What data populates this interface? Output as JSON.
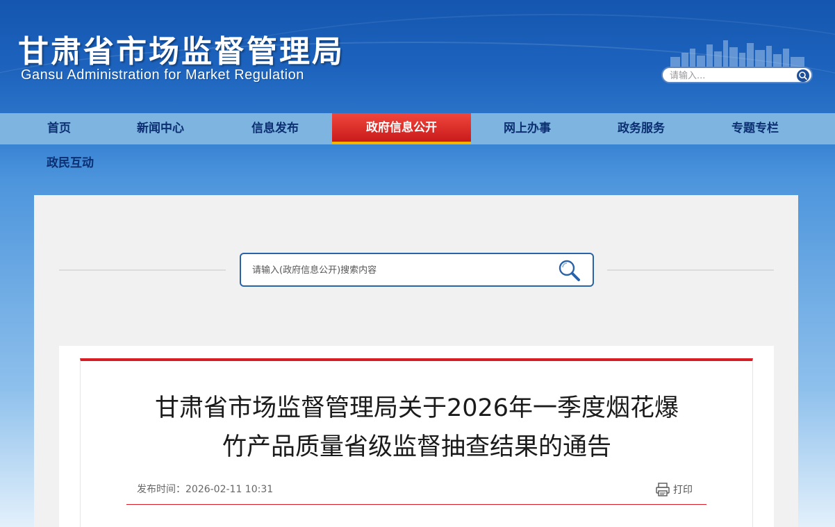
{
  "header": {
    "title_cn": "甘肃省市场监督管理局",
    "title_en": "Gansu Administration for Market Regulation",
    "search_placeholder": "请输入..."
  },
  "nav": {
    "items": [
      "首页",
      "新闻中心",
      "信息发布",
      "政府信息公开",
      "网上办事",
      "政务服务",
      "专题专栏"
    ],
    "active_index": 3,
    "second_row": "政民互动"
  },
  "gov_search": {
    "placeholder": "请输入(政府信息公开)搜索内容"
  },
  "article": {
    "title_line1": "甘肃省市场监督管理局关于2026年一季度烟花爆",
    "title_line2": "竹产品质量省级监督抽查结果的通告",
    "publish_label": "发布时间：",
    "publish_time": "2026-02-11 10:31",
    "print_label": "打印"
  },
  "colors": {
    "header_blue": "#1a5cb4",
    "nav_bg": "#7db5e0",
    "nav_text": "#0c2f72",
    "active_red": "#d9261f",
    "active_underline": "#f6b400",
    "accent_red": "#d71c24"
  },
  "icons": [
    "search-icon",
    "magnifier-icon",
    "printer-icon",
    "skyline-graphic"
  ]
}
